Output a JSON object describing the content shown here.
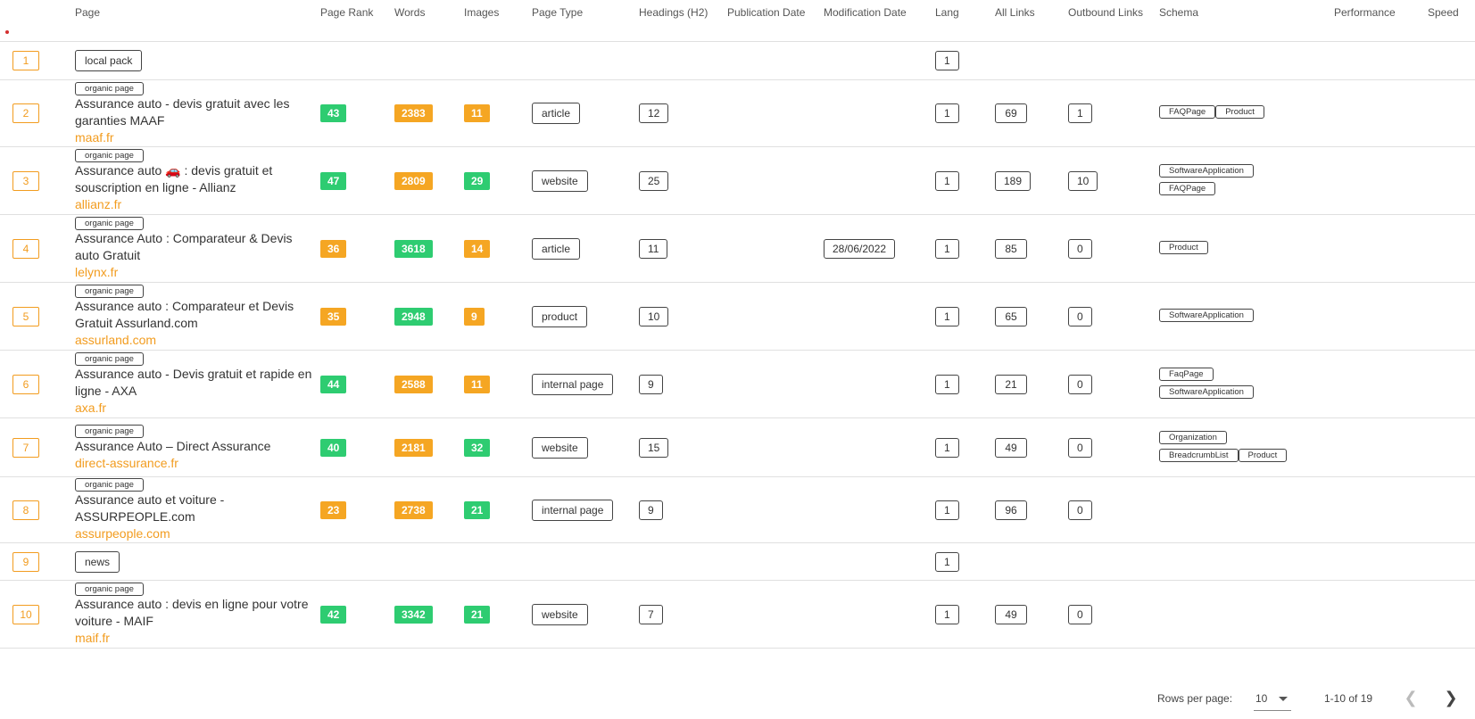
{
  "columns": [
    {
      "key": "rank",
      "label": ""
    },
    {
      "key": "page",
      "label": "Page"
    },
    {
      "key": "page_rank",
      "label": "Page Rank"
    },
    {
      "key": "words",
      "label": "Words"
    },
    {
      "key": "images",
      "label": "Images"
    },
    {
      "key": "page_type",
      "label": "Page Type"
    },
    {
      "key": "headings",
      "label": "Headings (H2)"
    },
    {
      "key": "publication",
      "label": "Publication Date"
    },
    {
      "key": "modification",
      "label": "Modification Date"
    },
    {
      "key": "lang",
      "label": "Lang"
    },
    {
      "key": "all_links",
      "label": "All Links"
    },
    {
      "key": "outbound",
      "label": "Outbound Links"
    },
    {
      "key": "schema",
      "label": "Schema"
    },
    {
      "key": "performance",
      "label": "Performance"
    },
    {
      "key": "speed",
      "label": "Speed"
    }
  ],
  "rows": [
    {
      "rank": "1",
      "chip": "local pack",
      "lang": "1"
    },
    {
      "rank": "2",
      "tag": "organic page",
      "title": "Assurance auto - devis gratuit avec les garanties MAAF",
      "domain": "maaf.fr",
      "page_rank": "43",
      "page_rank_color": "green",
      "words": "2383",
      "words_color": "orange",
      "images": "11",
      "images_color": "orange",
      "page_type": "article",
      "headings": "12",
      "publication": "",
      "modification": "",
      "lang": "1",
      "all_links": "69",
      "outbound": "1",
      "schema": [
        [
          "FAQPage",
          "Product"
        ]
      ]
    },
    {
      "rank": "3",
      "tag": "organic page",
      "title": "Assurance auto 🚗 : devis gratuit et souscription en ligne - Allianz",
      "domain": "allianz.fr",
      "page_rank": "47",
      "page_rank_color": "green",
      "words": "2809",
      "words_color": "orange",
      "images": "29",
      "images_color": "green",
      "page_type": "website",
      "headings": "25",
      "publication": "",
      "modification": "",
      "lang": "1",
      "all_links": "189",
      "outbound": "10",
      "schema": [
        [
          "SoftwareApplication"
        ],
        [
          "FAQPage"
        ]
      ]
    },
    {
      "rank": "4",
      "tag": "organic page",
      "title": "Assurance Auto : Comparateur & Devis auto Gratuit",
      "domain": "lelynx.fr",
      "page_rank": "36",
      "page_rank_color": "orange",
      "words": "3618",
      "words_color": "green",
      "images": "14",
      "images_color": "orange",
      "page_type": "article",
      "headings": "11",
      "publication": "",
      "modification": "28/06/2022",
      "lang": "1",
      "all_links": "85",
      "outbound": "0",
      "schema": [
        [
          "Product"
        ]
      ]
    },
    {
      "rank": "5",
      "tag": "organic page",
      "title": "Assurance auto : Comparateur et Devis Gratuit Assurland.com",
      "domain": "assurland.com",
      "page_rank": "35",
      "page_rank_color": "orange",
      "words": "2948",
      "words_color": "green",
      "images": "9",
      "images_color": "orange",
      "page_type": "product",
      "headings": "10",
      "publication": "",
      "modification": "",
      "lang": "1",
      "all_links": "65",
      "outbound": "0",
      "schema": [
        [
          "SoftwareApplication"
        ]
      ]
    },
    {
      "rank": "6",
      "tag": "organic page",
      "title": "Assurance auto - Devis gratuit et rapide en ligne - AXA",
      "domain": "axa.fr",
      "page_rank": "44",
      "page_rank_color": "green",
      "words": "2588",
      "words_color": "orange",
      "images": "11",
      "images_color": "orange",
      "page_type": "internal page",
      "headings": "9",
      "publication": "",
      "modification": "",
      "lang": "1",
      "all_links": "21",
      "outbound": "0",
      "schema": [
        [
          "FaqPage"
        ],
        [
          "SoftwareApplication"
        ]
      ]
    },
    {
      "rank": "7",
      "tag": "organic page",
      "title": "Assurance Auto – Direct Assurance",
      "domain": "direct-assurance.fr",
      "page_rank": "40",
      "page_rank_color": "green",
      "words": "2181",
      "words_color": "orange",
      "images": "32",
      "images_color": "green",
      "page_type": "website",
      "headings": "15",
      "publication": "",
      "modification": "",
      "lang": "1",
      "all_links": "49",
      "outbound": "0",
      "schema": [
        [
          "Organization"
        ],
        [
          "BreadcrumbList",
          "Product"
        ]
      ]
    },
    {
      "rank": "8",
      "tag": "organic page",
      "title": "Assurance auto et voiture - ASSURPEOPLE.com",
      "domain": "assurpeople.com",
      "page_rank": "23",
      "page_rank_color": "orange",
      "words": "2738",
      "words_color": "orange",
      "images": "21",
      "images_color": "green",
      "page_type": "internal page",
      "headings": "9",
      "publication": "",
      "modification": "",
      "lang": "1",
      "all_links": "96",
      "outbound": "0",
      "schema": []
    },
    {
      "rank": "9",
      "chip": "news",
      "lang": "1"
    },
    {
      "rank": "10",
      "tag": "organic page",
      "title": "Assurance auto : devis en ligne pour votre voiture - MAIF",
      "domain": "maif.fr",
      "page_rank": "42",
      "page_rank_color": "green",
      "words": "3342",
      "words_color": "green",
      "images": "21",
      "images_color": "green",
      "page_type": "website",
      "headings": "7",
      "publication": "",
      "modification": "",
      "lang": "1",
      "all_links": "49",
      "outbound": "0",
      "schema": []
    }
  ],
  "footer": {
    "rows_per_page_label": "Rows per page:",
    "rows_per_page_value": "10",
    "range": "1-10 of 19",
    "prev_icon": "chevron-left-icon",
    "next_icon": "chevron-right-icon"
  },
  "colors": {
    "green": "#2ecc71",
    "orange": "#f5a623",
    "accent": "#f29c1f"
  }
}
